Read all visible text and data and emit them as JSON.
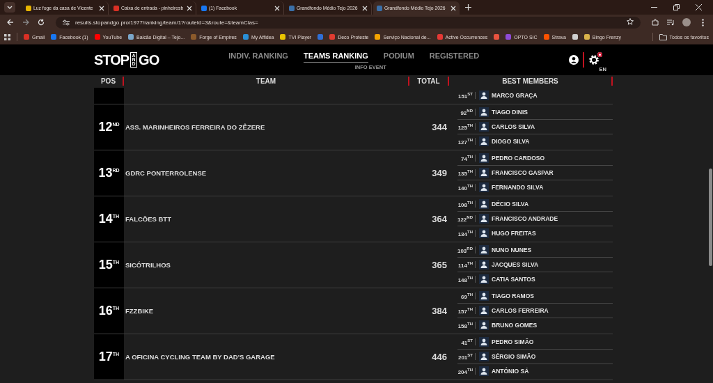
{
  "browser": {
    "tabs": [
      {
        "title": "Luz foge da casa de Vicente",
        "color": "#e8b400",
        "selected": false
      },
      {
        "title": "Caixa de entrada - pinheirosb",
        "color": "#d93025",
        "selected": false
      },
      {
        "title": "(1) Facebook",
        "color": "#1877f2",
        "selected": false
      },
      {
        "title": "Grandfondo Médio Tejo 2026",
        "color": "#3a6fa8",
        "selected": false
      },
      {
        "title": "Grandfondo Médio Tejo 2026",
        "color": "#3a6fa8",
        "selected": true
      }
    ],
    "url": "results.stopandgo.pro/1977/ranking/team/1?routeId=3&route=&teamClas=",
    "bookmarks": [
      {
        "label": "Gmail",
        "color": "#d93025"
      },
      {
        "label": "Facebook (1)",
        "color": "#1877f2"
      },
      {
        "label": "YouTube",
        "color": "#ff0000"
      },
      {
        "label": "Balcão Digital – Tejo...",
        "color": "#7aa6c9"
      },
      {
        "label": "Forge of Empires",
        "color": "#8b5a2b"
      },
      {
        "label": "My Affidea",
        "color": "#2a8fd6"
      },
      {
        "label": "TVI Player",
        "color": "#e8c300"
      },
      {
        "color": "#2f6fd6"
      },
      {
        "label": "Deco Proteste",
        "color": "#e03c31"
      },
      {
        "label": "Serviço Nacional de...",
        "color": "#f4a300"
      },
      {
        "label": "Active Occurrences",
        "color": "#e53935"
      },
      {
        "color": "#e8533f"
      },
      {
        "label": "OPTO SIC",
        "color": "#8e4bd6"
      },
      {
        "label": "Strava",
        "color": "#fc5200"
      },
      {
        "color": "#cfcfcf"
      },
      {
        "label": "Bingo Frenzy",
        "color": "#d9b24a"
      }
    ],
    "all_bookmarks": "Todos os favoritos"
  },
  "site": {
    "logo": [
      "STOP",
      "AND",
      "GO"
    ],
    "nav": [
      {
        "label": "INDIV. RANKING",
        "selected": false
      },
      {
        "label": "TEAMS RANKING",
        "selected": true
      },
      {
        "label": "PODIUM",
        "selected": false
      },
      {
        "label": "REGISTERED",
        "selected": false
      }
    ],
    "sub_nav": "INFO EVENT",
    "language": "EN"
  },
  "table": {
    "columns": [
      "POS",
      "TEAM",
      "TOTAL",
      "BEST MEMBERS"
    ],
    "rows": [
      {
        "members": [
          {
            "rank": "151$^{ST}$",
            "name": "MARCO GRAÇA"
          }
        ]
      },
      {
        "pos": "12$^{ND}$",
        "team": "ASS. MARINHEIROS FERREIRA DO ZÊZERE",
        "total": "344",
        "members": [
          {
            "rank": "92$^{ND}$",
            "name": "TIAGO DINIS"
          },
          {
            "rank": "125$^{TH}$",
            "name": "CARLOS SILVA"
          },
          {
            "rank": "127$^{TH}$",
            "name": "DIOGO SILVA"
          }
        ]
      },
      {
        "pos": "13$^{RD}$",
        "team": "GDRC PONTERROLENSE",
        "total": "349",
        "members": [
          {
            "rank": "74$^{TH}$",
            "name": "PEDRO CARDOSO"
          },
          {
            "rank": "135$^{TH}$",
            "name": "FRANCISCO GASPAR"
          },
          {
            "rank": "140$^{TH}$",
            "name": "FERNANDO SILVA"
          }
        ]
      },
      {
        "pos": "14$^{TH}$",
        "team": "FALCÕES BTT",
        "total": "364",
        "members": [
          {
            "rank": "108$^{TH}$",
            "name": "DÉCIO SILVA"
          },
          {
            "rank": "122$^{ND}$",
            "name": "FRANCISCO ANDRADE"
          },
          {
            "rank": "134$^{TH}$",
            "name": "HUGO FREITAS"
          }
        ]
      },
      {
        "pos": "15$^{TH}$",
        "team": "SICÓTRILHOS",
        "total": "365",
        "members": [
          {
            "rank": "103$^{RD}$",
            "name": "NUNO NUNES"
          },
          {
            "rank": "114$^{TH}$",
            "name": "JACQUES SILVA"
          },
          {
            "rank": "148$^{TH}$",
            "name": "CATIA SANTOS"
          }
        ]
      },
      {
        "pos": "16$^{TH}$",
        "team": "FZZBIKE",
        "total": "384",
        "members": [
          {
            "rank": "69$^{TH}$",
            "name": "TIAGO RAMOS"
          },
          {
            "rank": "157$^{TH}$",
            "name": "CARLOS FERREIRA"
          },
          {
            "rank": "158$^{TH}$",
            "name": "BRUNO GOMES"
          }
        ]
      },
      {
        "pos": "17$^{TH}$",
        "team": "A OFICINA CYCLING TEAM BY DAD'S GARAGE",
        "total": "446",
        "members": [
          {
            "rank": "41$^{ST}$",
            "name": "PEDRO SIMÃO"
          },
          {
            "rank": "201$^{ST}$",
            "name": "SÉRGIO SIMÃO"
          },
          {
            "rank": "204$^{TH}$",
            "name": "ANTÓNIO SÁ"
          }
        ]
      }
    ]
  }
}
